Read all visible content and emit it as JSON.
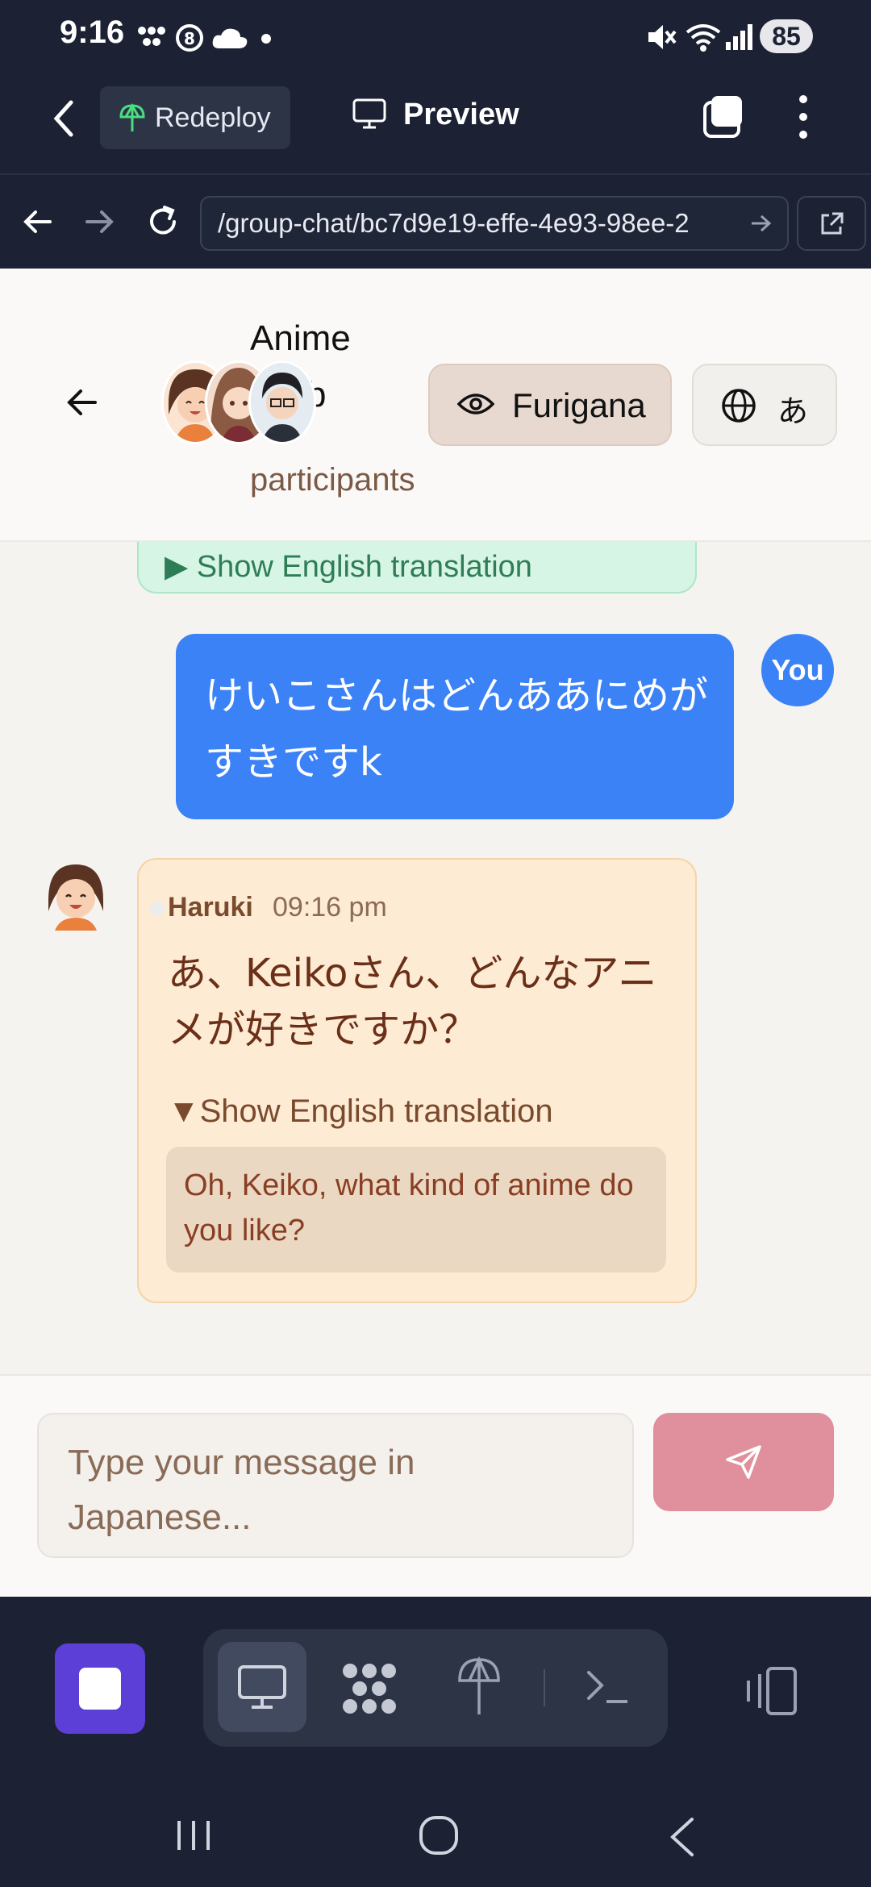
{
  "status_bar": {
    "time": "9:16",
    "battery": "85",
    "icons": [
      "grid-icon",
      "sync-icon",
      "cloud-icon",
      "dot-icon",
      "mute-icon",
      "wifi-icon",
      "signal-icon"
    ]
  },
  "app_bar": {
    "back_icon": "back-chevron-icon",
    "redeploy_label": "Redeploy",
    "preview_label": "Preview",
    "tabs_icon": "tabs-icon",
    "more_icon": "more-vertical-icon"
  },
  "browser_bar": {
    "url": "/group-chat/bc7d9e19-effe-4e93-98ee-2",
    "icons": [
      "arrow-left-icon",
      "arrow-right-icon",
      "reload-icon",
      "external-link-icon"
    ]
  },
  "chat_header": {
    "title_line1": "Anime",
    "title_line2": "b",
    "participants_label": "participants",
    "furigana_label": "Furigana",
    "language_label": "あ"
  },
  "messages": {
    "previous_toggle": "▶ Show English translation",
    "user_badge": "You",
    "user_text": "けいこさんはどんああにめがすきですk",
    "bot": {
      "sender": "Haruki",
      "time": "09:16 pm",
      "text": "あ、Keikoさん、どんなアニメが好きですか？",
      "toggle": "▼Show English translation",
      "translation": "Oh, Keiko, what kind of anime do you like?"
    }
  },
  "composer": {
    "placeholder": "Type your message in Japanese...",
    "send_icon": "send-icon"
  },
  "toolbar": {
    "items": [
      "stop-icon",
      "desktop-icon",
      "nodes-icon",
      "deploy-icon",
      "terminal-icon",
      "device-icon"
    ]
  },
  "colors": {
    "dark_bg": "#1c2233",
    "user_bubble": "#3b82f6",
    "bot_bubble": "#fdebd3",
    "send_button": "#e0909c",
    "accent_purple": "#5b3fd6"
  }
}
